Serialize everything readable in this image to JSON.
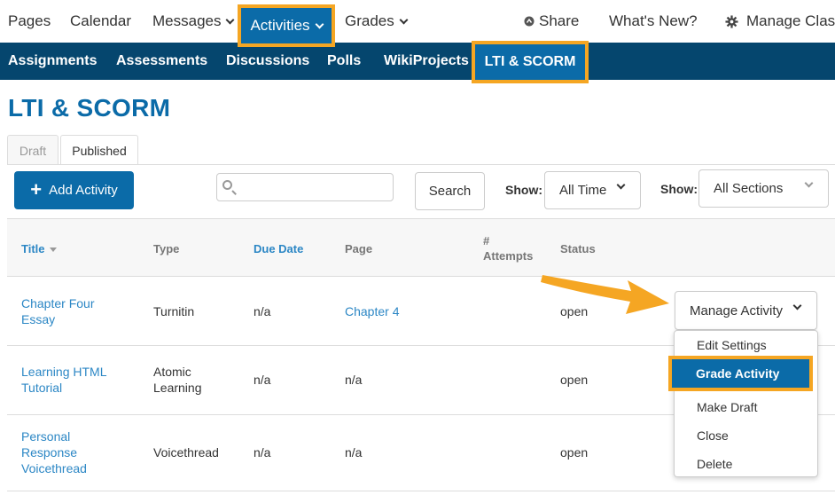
{
  "topnav": {
    "pages": "Pages",
    "calendar": "Calendar",
    "messages": "Messages",
    "activities": "Activities",
    "grades": "Grades",
    "share": "Share",
    "whats_new": "What's New?",
    "manage_class": "Manage Class"
  },
  "subnav": {
    "assignments": "Assignments",
    "assessments": "Assessments",
    "discussions": "Discussions",
    "polls": "Polls",
    "wikiprojects": "WikiProjects",
    "lti_scorm": "LTI & SCORM"
  },
  "page_title": "LTI & SCORM",
  "tabs": {
    "draft": "Draft",
    "published": "Published"
  },
  "toolbar": {
    "add_activity": "Add Activity",
    "search_placeholder": "",
    "search_button": "Search",
    "show_label_1": "Show:",
    "show_value_1": "All Time",
    "show_label_2": "Show:",
    "show_value_2": "All Sections"
  },
  "table": {
    "headers": {
      "title": "Title",
      "type": "Type",
      "due_date": "Due Date",
      "page": "Page",
      "attempts_1": "#",
      "attempts_2": "Attempts",
      "status": "Status"
    },
    "rows": [
      {
        "title_1": "Chapter Four",
        "title_2": "Essay",
        "title_3": "",
        "type_1": "Turnitin",
        "type_2": "",
        "due": "n/a",
        "page": "Chapter 4",
        "status": "open"
      },
      {
        "title_1": "Learning HTML",
        "title_2": "Tutorial",
        "title_3": "",
        "type_1": "Atomic",
        "type_2": "Learning",
        "due": "n/a",
        "page": "n/a",
        "status": "open"
      },
      {
        "title_1": "Personal",
        "title_2": "Response",
        "title_3": "Voicethread",
        "type_1": "Voicethread",
        "type_2": "",
        "due": "n/a",
        "page": "n/a",
        "status": "open"
      }
    ]
  },
  "manage": {
    "button": "Manage Activity",
    "items": {
      "edit_settings": "Edit Settings",
      "grade_activity": "Grade Activity",
      "make_draft": "Make Draft",
      "close": "Close",
      "delete": "Delete"
    }
  },
  "colors": {
    "accent": "#0b6ba8",
    "subnav_bg": "#05466e",
    "highlight": "#f5a623",
    "link": "#2c87c5"
  }
}
